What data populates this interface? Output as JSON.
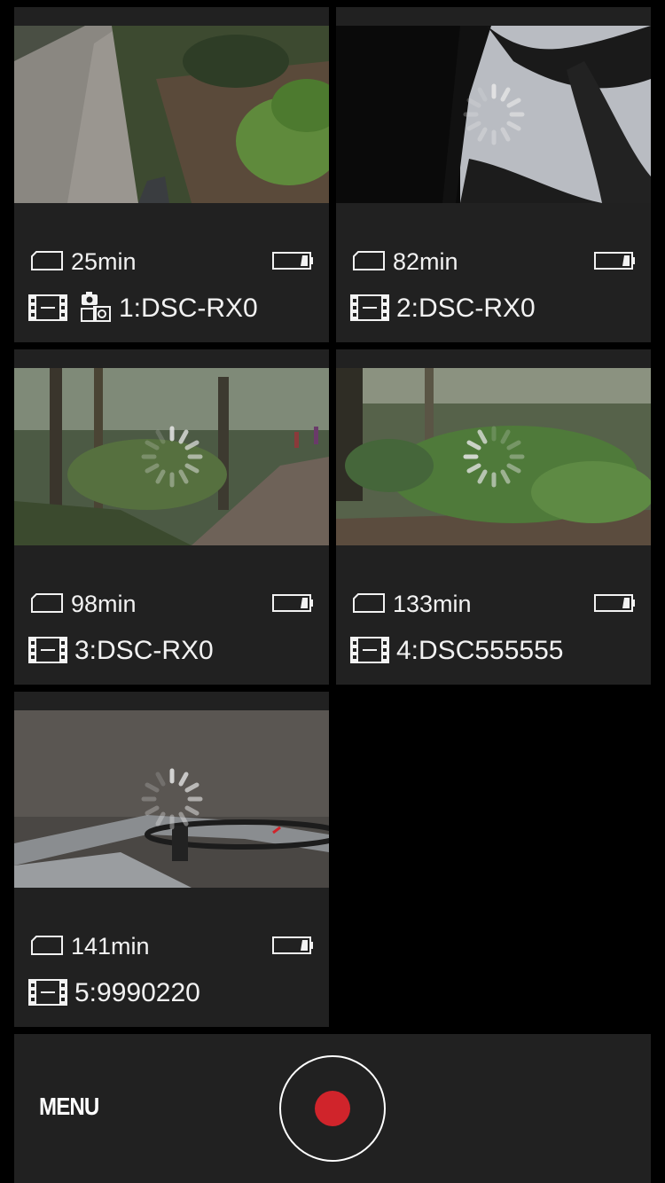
{
  "cameras": [
    {
      "remaining": "25min",
      "name": "1:DSC-RX0",
      "has_stills_icon": true,
      "loading": false,
      "scene": "trail"
    },
    {
      "remaining": "82min",
      "name": "2:DSC-RX0",
      "has_stills_icon": false,
      "loading": true,
      "scene": "sky"
    },
    {
      "remaining": "98min",
      "name": "3:DSC-RX0",
      "has_stills_icon": false,
      "loading": true,
      "scene": "forest-path"
    },
    {
      "remaining": "133min",
      "name": "4:DSC555555",
      "has_stills_icon": false,
      "loading": true,
      "scene": "ferns"
    },
    {
      "remaining": "141min",
      "name": "5:9990220",
      "has_stills_icon": false,
      "loading": true,
      "scene": "bike"
    }
  ],
  "bottom_bar": {
    "menu_label": "MENU",
    "record_icon": "record-icon"
  },
  "colors": {
    "background": "#000000",
    "tile": "#212121",
    "record": "#d0242b",
    "text": "#f2f2f2"
  }
}
